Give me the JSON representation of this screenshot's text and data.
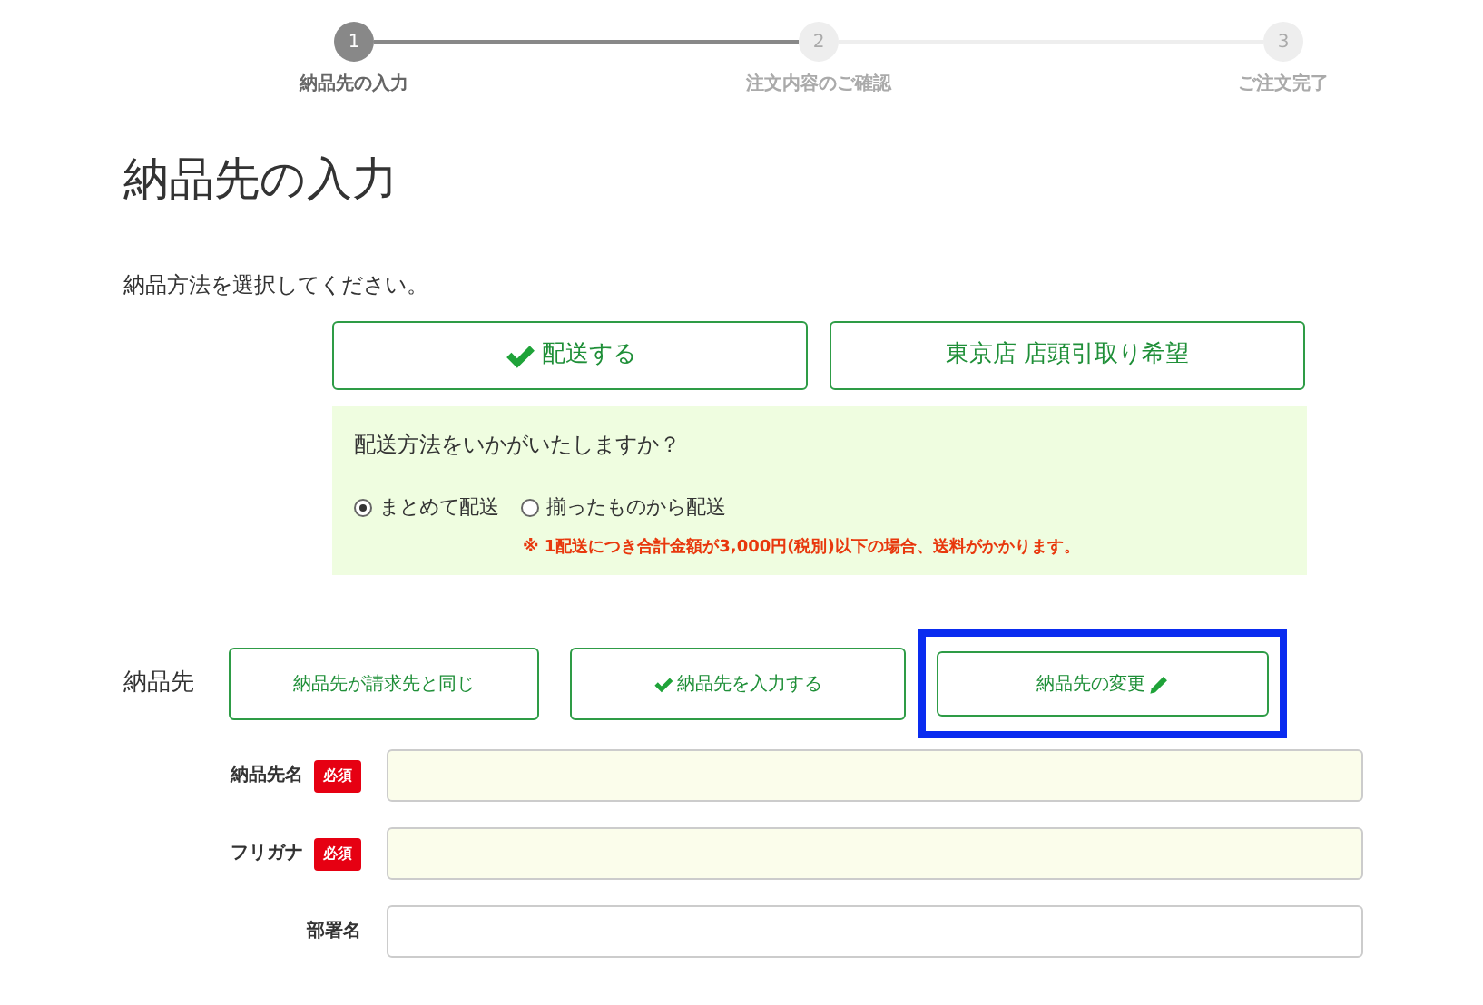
{
  "steps": [
    {
      "number": "1",
      "label": "納品先の入力",
      "active": true
    },
    {
      "number": "2",
      "label": "注文内容のご確認",
      "active": false
    },
    {
      "number": "3",
      "label": "ご注文完了",
      "active": false
    }
  ],
  "title": "納品先の入力",
  "method_prompt": "納品方法を選択してください。",
  "methods": [
    {
      "label": "配送する",
      "selected": true
    },
    {
      "label": "東京店 店頭引取り希望",
      "selected": false
    }
  ],
  "shipping_panel": {
    "question": "配送方法をいかがいたしますか？",
    "options": [
      {
        "label": "まとめて配送",
        "checked": true
      },
      {
        "label": "揃ったものから配送",
        "checked": false
      }
    ],
    "note": "※ 1配送につき合計金額が3,000円(税別)以下の場合、送料がかかります。"
  },
  "destination": {
    "label": "納品先",
    "choices": [
      {
        "label": "納品先が請求先と同じ",
        "selected": false,
        "highlighted": false,
        "kind": "plain"
      },
      {
        "label": "納品先を入力する",
        "selected": true,
        "highlighted": false,
        "kind": "plain"
      },
      {
        "label": "納品先の変更",
        "selected": false,
        "highlighted": true,
        "kind": "edit"
      }
    ]
  },
  "fields": [
    {
      "label": "納品先名",
      "required": true,
      "badge": "必須"
    },
    {
      "label": "フリガナ",
      "required": true,
      "badge": "必須"
    },
    {
      "label": "部署名",
      "required": false
    }
  ]
}
